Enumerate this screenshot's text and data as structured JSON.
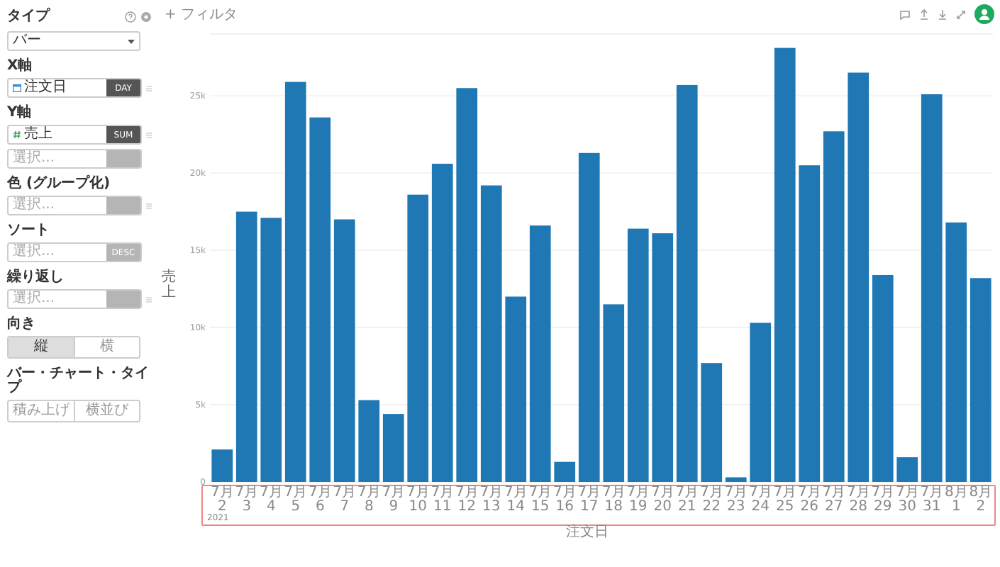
{
  "panel": {
    "title": "タイプ",
    "chart_type": "バー",
    "sections": [
      {
        "label": "X軸",
        "rows": [
          {
            "kind": "date",
            "value": "注文日",
            "agg": {
              "text": "DAY",
              "disabled": false
            },
            "handle": true
          }
        ]
      },
      {
        "label": "Y軸",
        "rows": [
          {
            "kind": "measure",
            "value": "売上",
            "agg": {
              "text": "SUM",
              "disabled": false
            },
            "handle": true
          },
          {
            "kind": "empty",
            "placeholder": "選択...",
            "agg": {
              "disabled": true
            },
            "handle": false
          }
        ]
      },
      {
        "label": "色 (グループ化)",
        "rows": [
          {
            "kind": "empty",
            "placeholder": "選択...",
            "agg": {
              "disabled": true
            },
            "handle": true
          }
        ]
      },
      {
        "label": "ソート",
        "rows": [
          {
            "kind": "empty",
            "placeholder": "選択...",
            "agg": {
              "text": "DESC",
              "disabled": true
            },
            "handle": false
          }
        ]
      },
      {
        "label": "繰り返し",
        "rows": [
          {
            "kind": "empty",
            "placeholder": "選択...",
            "agg": {
              "disabled": true
            },
            "handle": true
          }
        ]
      }
    ],
    "orientation": {
      "label": "向き",
      "options": [
        {
          "label": "縦",
          "selected": true
        },
        {
          "label": "横",
          "selected": false
        }
      ]
    },
    "bar_type": {
      "label": "バー・チャート・タイプ",
      "options": [
        {
          "label": "積み上げ",
          "selected": false
        },
        {
          "label": "横並び",
          "selected": false
        }
      ]
    }
  },
  "toolbar": {
    "filter": "+ フィルタ"
  },
  "chart": {
    "year": "2021",
    "chart_data": {
      "type": "bar",
      "xlabel": "注文日",
      "ylabel": "売上",
      "color": "#1f77b4",
      "grid": true,
      "ylim": [
        0,
        29000
      ],
      "yticks": [
        {
          "value": 0,
          "label": "0"
        },
        {
          "value": 5000,
          "label": "5k"
        },
        {
          "value": 10000,
          "label": "10k"
        },
        {
          "value": 15000,
          "label": "15k"
        },
        {
          "value": 20000,
          "label": "20k"
        },
        {
          "value": 25000,
          "label": "25k"
        }
      ],
      "categories": [
        "7月 2",
        "7月 3",
        "7月 4",
        "7月 5",
        "7月 6",
        "7月 7",
        "7月 8",
        "7月 9",
        "7月 10",
        "7月 11",
        "7月 12",
        "7月 13",
        "7月 14",
        "7月 15",
        "7月 16",
        "7月 17",
        "7月 18",
        "7月 19",
        "7月 20",
        "7月 21",
        "7月 22",
        "7月 23",
        "7月 24",
        "7月 25",
        "7月 26",
        "7月 27",
        "7月 28",
        "7月 29",
        "7月 30",
        "7月 31",
        "8月 1",
        "8月 2"
      ],
      "values": [
        2100,
        17500,
        17100,
        25900,
        23600,
        17000,
        5300,
        4400,
        18600,
        20600,
        25500,
        19200,
        12000,
        16600,
        1300,
        21300,
        11500,
        16400,
        16100,
        25700,
        7700,
        300,
        10300,
        28100,
        20500,
        22700,
        26500,
        13400,
        1600,
        25100,
        16800,
        13200
      ]
    }
  }
}
